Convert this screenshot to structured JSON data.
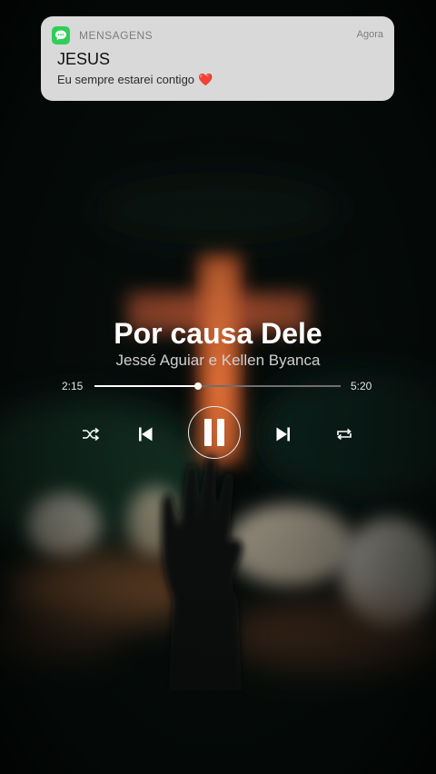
{
  "notification": {
    "app_name": "MENSAGENS",
    "time": "Agora",
    "sender": "JESUS",
    "message": "Eu sempre estarei contigo",
    "app_icon": "messages-icon",
    "emoji": "❤️"
  },
  "player": {
    "title": "Por causa Dele",
    "artist": "Jessé Aguiar e Kellen Byanca",
    "elapsed": "2:15",
    "duration": "5:20",
    "progress": 0.42,
    "controls": {
      "shuffle": "shuffle-icon",
      "previous": "skip-previous-icon",
      "play_pause": "pause-icon",
      "next": "skip-next-icon",
      "repeat": "repeat-icon"
    }
  },
  "colors": {
    "background": "#040807",
    "notification_bg": "#d9d9d9",
    "app_icon": "#2fcf57",
    "cross_glow": "#e0602a",
    "heart": "#e0142c"
  }
}
